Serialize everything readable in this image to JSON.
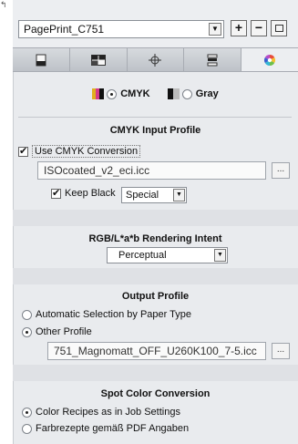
{
  "toolbar": {
    "preset_value": "PagePrint_C751",
    "add_label": "+",
    "remove_label": "−"
  },
  "tabs": [
    {
      "icon": "page-icon"
    },
    {
      "icon": "layout-icon"
    },
    {
      "icon": "crosshair-icon"
    },
    {
      "icon": "stack-icon"
    },
    {
      "icon": "color-wheel-icon",
      "active": true
    }
  ],
  "mode": {
    "cmyk_label": "CMYK",
    "gray_label": "Gray",
    "selected": "CMYK"
  },
  "cmyk_input": {
    "title": "CMYK Input Profile",
    "use_conversion_label": "Use CMYK Conversion",
    "use_conversion_checked": true,
    "profile_value": "ISOcoated_v2_eci.icc",
    "browse_label": "...",
    "keep_black_label": "Keep Black",
    "keep_black_checked": true,
    "keep_black_option": "Special"
  },
  "rendering": {
    "title": "RGB/L*a*b Rendering Intent",
    "intent_value": "Perceptual"
  },
  "output": {
    "title": "Output Profile",
    "auto_label": "Automatic Selection by Paper Type",
    "other_label": "Other Profile",
    "selected": "Other Profile",
    "profile_value": "751_Magnomatt_OFF_U260K100_7-5.icc",
    "browse_label": "..."
  },
  "spot": {
    "title": "Spot Color Conversion",
    "option1_label": "Color Recipes as in Job Settings",
    "option2_label": "Farbrezepte gemäß PDF Angaben",
    "selected": "Color Recipes as in Job Settings"
  },
  "colors": {
    "panel_bg": "#e9ebee",
    "accent": "#3a6ea5"
  }
}
